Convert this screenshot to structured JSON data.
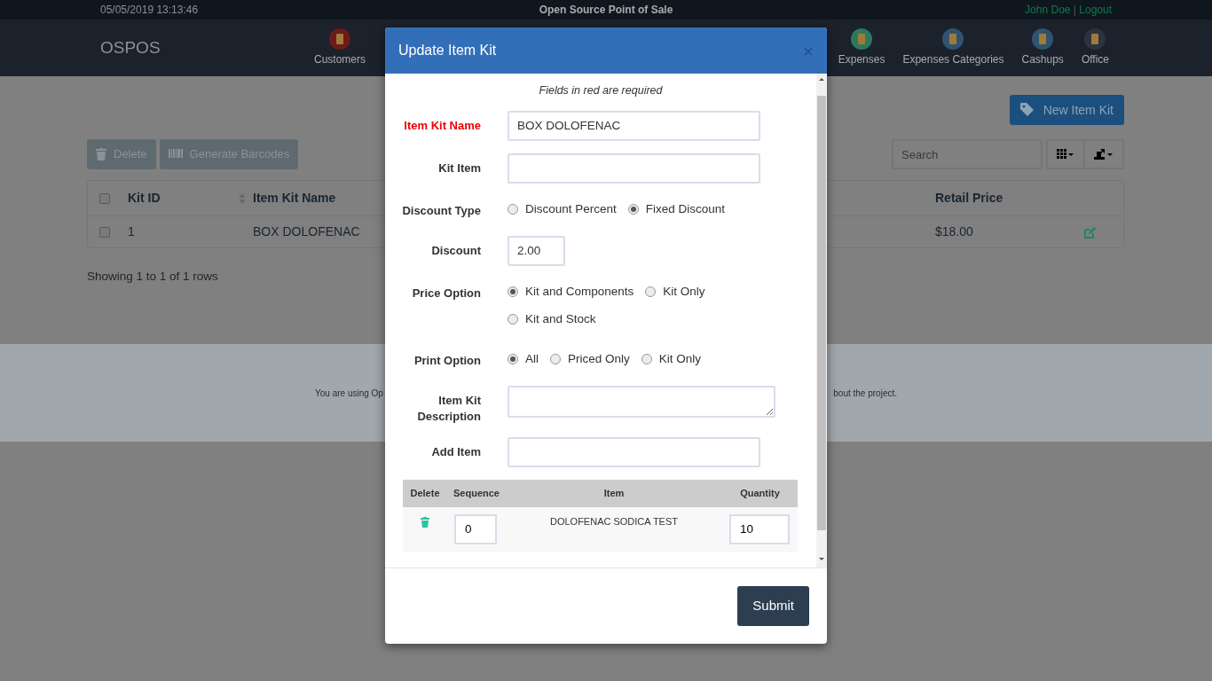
{
  "top_bar": {
    "datetime": "05/05/2019 13:13:46",
    "title": "Open Source Point of Sale",
    "user": "John Doe",
    "separator": "|",
    "logout": "Logout"
  },
  "navbar": {
    "brand": "OSPOS",
    "items": [
      {
        "label": "Customers",
        "color": "#6e1a1a"
      },
      {
        "label": "Expenses",
        "color": "#2b7a5c"
      },
      {
        "label": "Expenses Categories",
        "color": "#2f5470"
      },
      {
        "label": "Cashups",
        "color": "#2f5470"
      },
      {
        "label": "Office",
        "color": "#2a3340"
      }
    ]
  },
  "page": {
    "new_button": "New Item Kit",
    "toolbar_buttons": [
      {
        "kind": "delete",
        "label": "Delete",
        "disabled": true
      },
      {
        "kind": "barcode",
        "label": "Generate Barcodes",
        "disabled": true
      }
    ],
    "search": {
      "placeholder": "Search"
    },
    "table": {
      "header_checked": false,
      "columns": [
        "Kit ID",
        "Item Kit Name",
        "Retail Price"
      ],
      "rows": [
        {
          "checked": false,
          "cells": [
            "1",
            "BOX DOLOFENAC",
            "$18.00"
          ]
        }
      ]
    },
    "pagination": "Showing 1 to 1 of 1 rows"
  },
  "footer": {
    "text_left": "You are using Op",
    "text_right": "bout the project."
  },
  "modal": {
    "title": "Update Item Kit",
    "close": "×",
    "required_note": "Fields in red are required",
    "fields": [
      {
        "kind": "text",
        "label": "Item Kit Name",
        "required": true,
        "value": "BOX DOLOFENAC"
      },
      {
        "kind": "text",
        "label": "Kit Item",
        "required": false
      },
      {
        "kind": "radio",
        "label": "Discount Type",
        "required": false,
        "options": [
          {
            "label": "Discount Percent",
            "selected": false
          },
          {
            "label": "Fixed Discount",
            "selected": true
          }
        ]
      },
      {
        "kind": "number",
        "label": "Discount",
        "required": false,
        "value": "2.00"
      },
      {
        "kind": "radio",
        "label": "Price Option",
        "required": false,
        "options": [
          {
            "label": "Kit and Components",
            "selected": true
          },
          {
            "label": "Kit Only",
            "selected": false
          },
          {
            "label": "Kit and Stock",
            "selected": false
          }
        ]
      },
      {
        "kind": "radio",
        "label": "Print Option",
        "required": false,
        "options": [
          {
            "label": "All",
            "selected": true
          },
          {
            "label": "Priced Only",
            "selected": false
          },
          {
            "label": "Kit Only",
            "selected": false
          }
        ]
      },
      {
        "kind": "textarea",
        "label": "Item Kit Description",
        "required": false
      },
      {
        "kind": "text",
        "label": "Add Item",
        "required": false
      }
    ],
    "items_table": {
      "columns": [
        "Delete",
        "Sequence",
        "Item",
        "Quantity"
      ],
      "rows": [
        {
          "sequence": "0",
          "item": "DOLOFENAC SODICA TEST",
          "quantity": "10"
        }
      ]
    },
    "submit": "Submit"
  }
}
